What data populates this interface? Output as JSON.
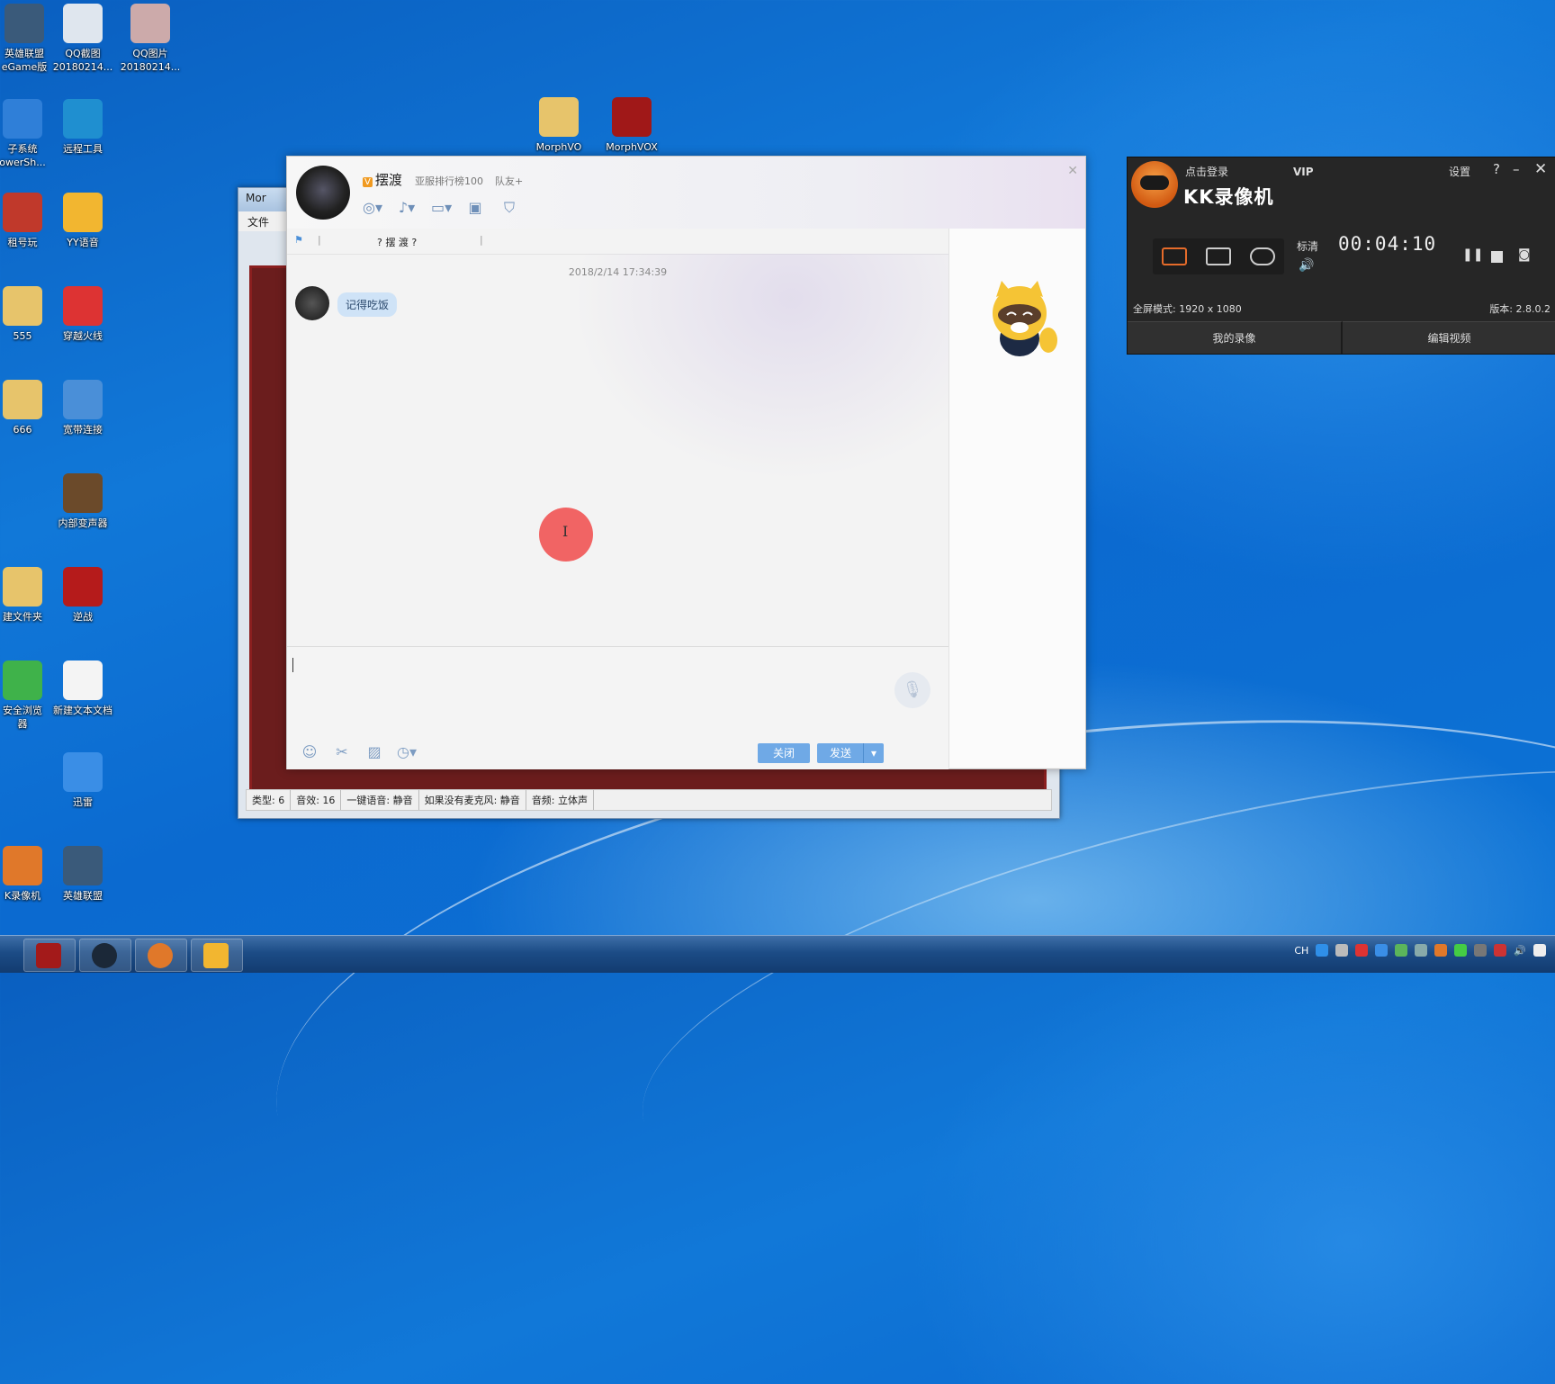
{
  "desktop_icons": [
    {
      "label1": "英雄联盟",
      "label2": "eGame版",
      "color": "#3a5a7a"
    },
    {
      "label1": "QQ截图",
      "label2": "20180214...",
      "color": "#dfe6ee"
    },
    {
      "label1": "QQ图片",
      "label2": "20180214...",
      "color": "#caa"
    },
    {
      "label1": "子系统",
      "label2": "owerSh...",
      "color": "#2f7fd8"
    },
    {
      "label1": "远程工具",
      "label2": "",
      "color": "#1f8fd0"
    },
    {
      "label1": "租号玩",
      "label2": "",
      "color": "#c0392b"
    },
    {
      "label1": "YY语音",
      "label2": "",
      "color": "#f2b630"
    },
    {
      "label1": "555",
      "label2": "",
      "color": "#e7c46b"
    },
    {
      "label1": "穿越火线",
      "label2": "",
      "color": "#d33"
    },
    {
      "label1": "666",
      "label2": "",
      "color": "#e7c46b"
    },
    {
      "label1": "宽带连接",
      "label2": "",
      "color": "#4a8fd8"
    },
    {
      "label1": "内部变声器",
      "label2": "",
      "color": "#6b4a2a"
    },
    {
      "label1": "建文件夹",
      "label2": "",
      "color": "#e7c46b"
    },
    {
      "label1": "逆战",
      "label2": "",
      "color": "#b51b1b"
    },
    {
      "label1": "安全浏览",
      "label2": "器",
      "color": "#3fb24a"
    },
    {
      "label1": "新建文本文档",
      "label2": "",
      "color": "#f4f4f4"
    },
    {
      "label1": "K录像机",
      "label2": "",
      "color": "#e0782a"
    },
    {
      "label1": "迅雷",
      "label2": "",
      "color": "#3a8ee6"
    },
    {
      "label1": "英雄联盟",
      "label2": "",
      "color": "#3a5a7a"
    },
    {
      "label1": "MorphVO",
      "label2": "",
      "color": "#e7c46b"
    },
    {
      "label1": "MorphVOX",
      "label2": "",
      "color": "#a01818"
    }
  ],
  "morph_window": {
    "title": "Mor",
    "menu_file": "文件",
    "status": [
      "类型: 6",
      "音效: 16",
      "一键语音: 静音",
      "如果没有麦克风: 静音",
      "音频: 立体声"
    ]
  },
  "chat": {
    "vip_badge": "V",
    "name": "摆渡",
    "rank": "亚服排行榜100",
    "add_friend": "队友+",
    "toolbar_text": "?  摆  渡  ?",
    "timestamp": "2018/2/14 17:34:39",
    "message": "记得吃饭",
    "close_button": "关闭",
    "send_button": "发送"
  },
  "kk": {
    "login": "点击登录",
    "vip": "VIP",
    "app_name": "KK录像机",
    "settings": "设置",
    "help": "?",
    "minimize": "–",
    "close": "✕",
    "quality": "标清",
    "timer": "00:04:10",
    "mode_info": "全屏模式: 1920 x 1080",
    "version": "版本: 2.8.0.2",
    "tab_my_recordings": "我的录像",
    "tab_edit_video": "编辑视频"
  },
  "taskbar": {
    "tray_lang": "CH"
  },
  "colors": {
    "accent_blue": "#6fa9e6",
    "kk_orange": "#e56b2a",
    "record_dot": "#f05050"
  }
}
